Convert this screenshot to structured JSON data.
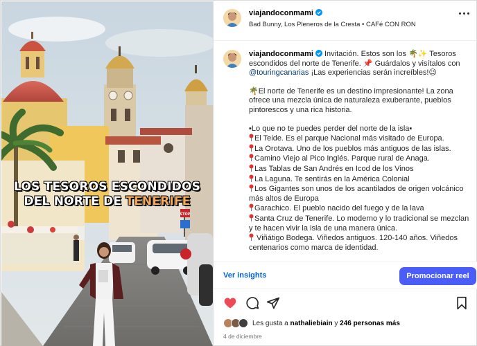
{
  "post": {
    "username": "viajandoconmami",
    "audio": "Bad Bunny, Los Pleneros de la Cresta • CAFé CON RON"
  },
  "media": {
    "overlay_line1": "LOS TESOROS ESCONDIDOS",
    "overlay_line2_prefix": "DEL NORTE DE ",
    "overlay_line2_accent": "TENERIFE",
    "sign_text": "STOP"
  },
  "caption": {
    "username": "viajandoconmami",
    "intro_a": "Invitación. Estos son los 🌴✨ Tesoros escondidos del norte de Tenerife. 📌 Guárdalos y visítalos con ",
    "mention": "@touringcanarias",
    "intro_b": " ¡Las experiencias serán increíbles!😉",
    "para2": "🌴El norte de Tenerife es un destino impresionante! La zona ofrece una mezcla única de naturaleza exuberante, pueblos pintorescos y una rica historia.",
    "list_title": "▪Lo que no te puedes perder del norte de la isla▪",
    "items": [
      "El Teide. Es el parque Nacional más visitado de Europa.",
      "La Orotava. Uno de los pueblos más antiguos de las islas.",
      "Camino Viejo al Pico Inglés. Parque rural de Anaga.",
      "Las Tablas de San Andrés en Icod de los Vinos",
      "La Laguna. Te sentirás en la América Colonial",
      "Los Gigantes son unos de los acantilados de origen volcánico más altos de Europa",
      "Garachico. El pueblo nacido del fuego y de la lava",
      "Santa Cruz de Tenerife. Lo moderno y lo tradicional se mezclan y te hacen vivir la isla de una manera única.",
      " Viñátigo Bodega. Viñedos antiguos. 120-140 años. Viñedos centenarios como marca de identidad."
    ]
  },
  "actions": {
    "insights_label": "Ver insights",
    "promote_label": "Promocionar reel"
  },
  "likes": {
    "prefix": "Les gusta a ",
    "user": "nathaliebiain",
    "middle": " y ",
    "count": "246 personas más"
  },
  "date": "4 de diciembre",
  "colors": {
    "link_blue": "#0064e0",
    "promote_bg": "#4a5df9",
    "like_red": "#ed4956",
    "verified_blue": "#0095f6"
  },
  "icons": [
    "verified-icon",
    "more-options-icon",
    "like-heart-icon",
    "comment-icon",
    "share-icon",
    "save-bookmark-icon",
    "location-pin-icon"
  ]
}
